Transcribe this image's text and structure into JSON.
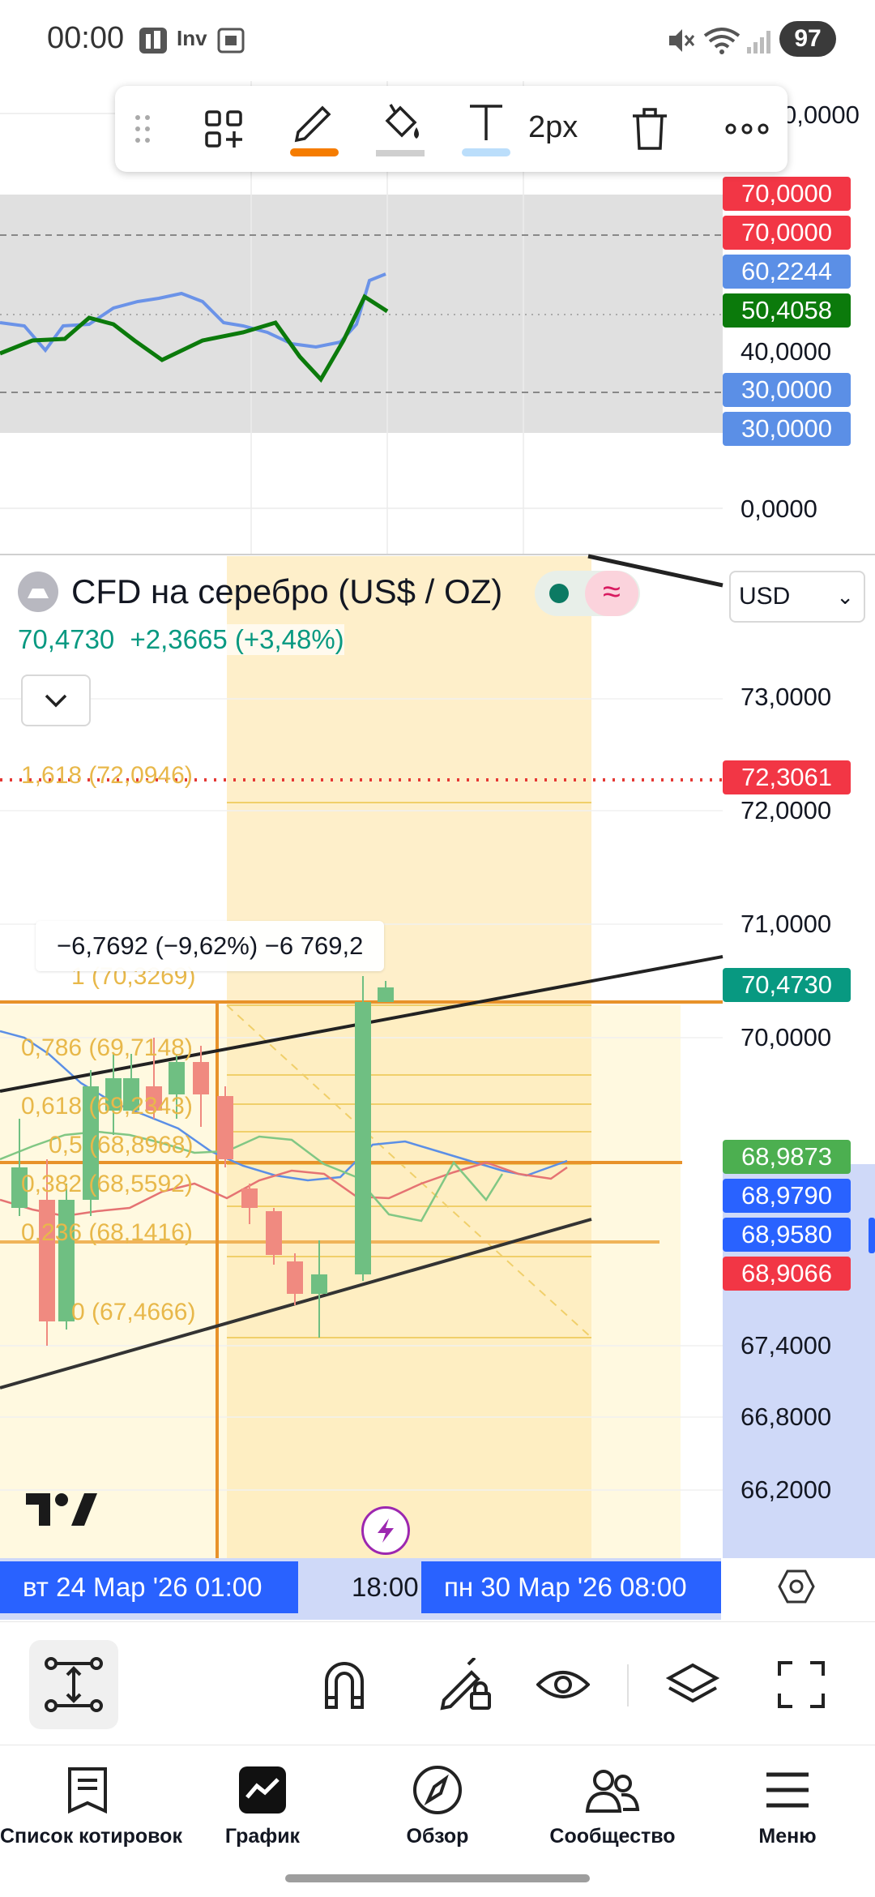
{
  "status_bar": {
    "time": "00:00",
    "battery": "97",
    "icons": [
      "app-icon",
      "inv-icon",
      "screenshot-icon",
      "mute-icon",
      "wifi-icon",
      "signal-icon"
    ],
    "inv_text": "Inv"
  },
  "draw_toolbar": {
    "stroke_width": "2px",
    "items": [
      "drag-handle-icon",
      "add-widget-icon",
      "pencil-icon",
      "fill-icon",
      "text-icon",
      "stroke-width",
      "trash-icon",
      "more-icon"
    ],
    "pencil_color": "#f57c00",
    "text_color": "#bbdefb"
  },
  "indicator_pane": {
    "axis_labels": {
      "top_cut": "0,0000",
      "level_70a": "70,0000",
      "level_70b": "70,0000",
      "blue_value": "60,2244",
      "green_value": "50,4058",
      "level_40": "40,0000",
      "level_30a": "30,0000",
      "level_30b": "30,0000",
      "level_0": "0,0000"
    },
    "colors": {
      "red": "#f23645",
      "blue": "#5b8fe6",
      "green": "#0b7a0b"
    }
  },
  "symbol": {
    "name": "CFD на серебро (US$ / OZ)",
    "last_price": "70,4730",
    "change": "+2,3665 (+3,48%)",
    "currency": "USD",
    "wave_glyph": "≈"
  },
  "price_axis": {
    "p73": "73,0000",
    "p7230": "72,3061",
    "p72": "72,0000",
    "p71": "71,0000",
    "p7047": "70,4730",
    "p70": "70,0000",
    "p6898": "68,9873",
    "p6897": "68,9790",
    "p6895": "68,9580",
    "p6890": "68,9066",
    "p674": "67,4000",
    "p668": "66,8000",
    "p662": "66,2000"
  },
  "measure_tooltip": "−6,7692 (−9,62%) −6 769,2",
  "fib_levels": [
    {
      "label": "1,618 (72,0946)"
    },
    {
      "label": "1 (70,3269)"
    },
    {
      "label": "0,786 (69,7148)"
    },
    {
      "label": "0,618 (69,2343)"
    },
    {
      "label": "0,5 (68,8968)"
    },
    {
      "label": "0,382 (68,5592)"
    },
    {
      "label": "0,236 (68,1416)"
    },
    {
      "label": "0 (67,4666)"
    }
  ],
  "time_axis": {
    "left_tag": "вт 24 Мар '26   01:00",
    "middle": "18:00",
    "right_tag": "пн 30 Мар '26   08:00"
  },
  "chart_tools": [
    "measure-icon",
    "magnet-icon",
    "lock-drawing-icon",
    "eye-icon",
    "layers-icon",
    "fullscreen-icon"
  ],
  "nav": [
    {
      "label": "Список котировок",
      "icon": "watchlist-icon"
    },
    {
      "label": "График",
      "icon": "chart-icon"
    },
    {
      "label": "Обзор",
      "icon": "compass-icon"
    },
    {
      "label": "Сообщество",
      "icon": "community-icon"
    },
    {
      "label": "Меню",
      "icon": "menu-icon"
    }
  ]
}
